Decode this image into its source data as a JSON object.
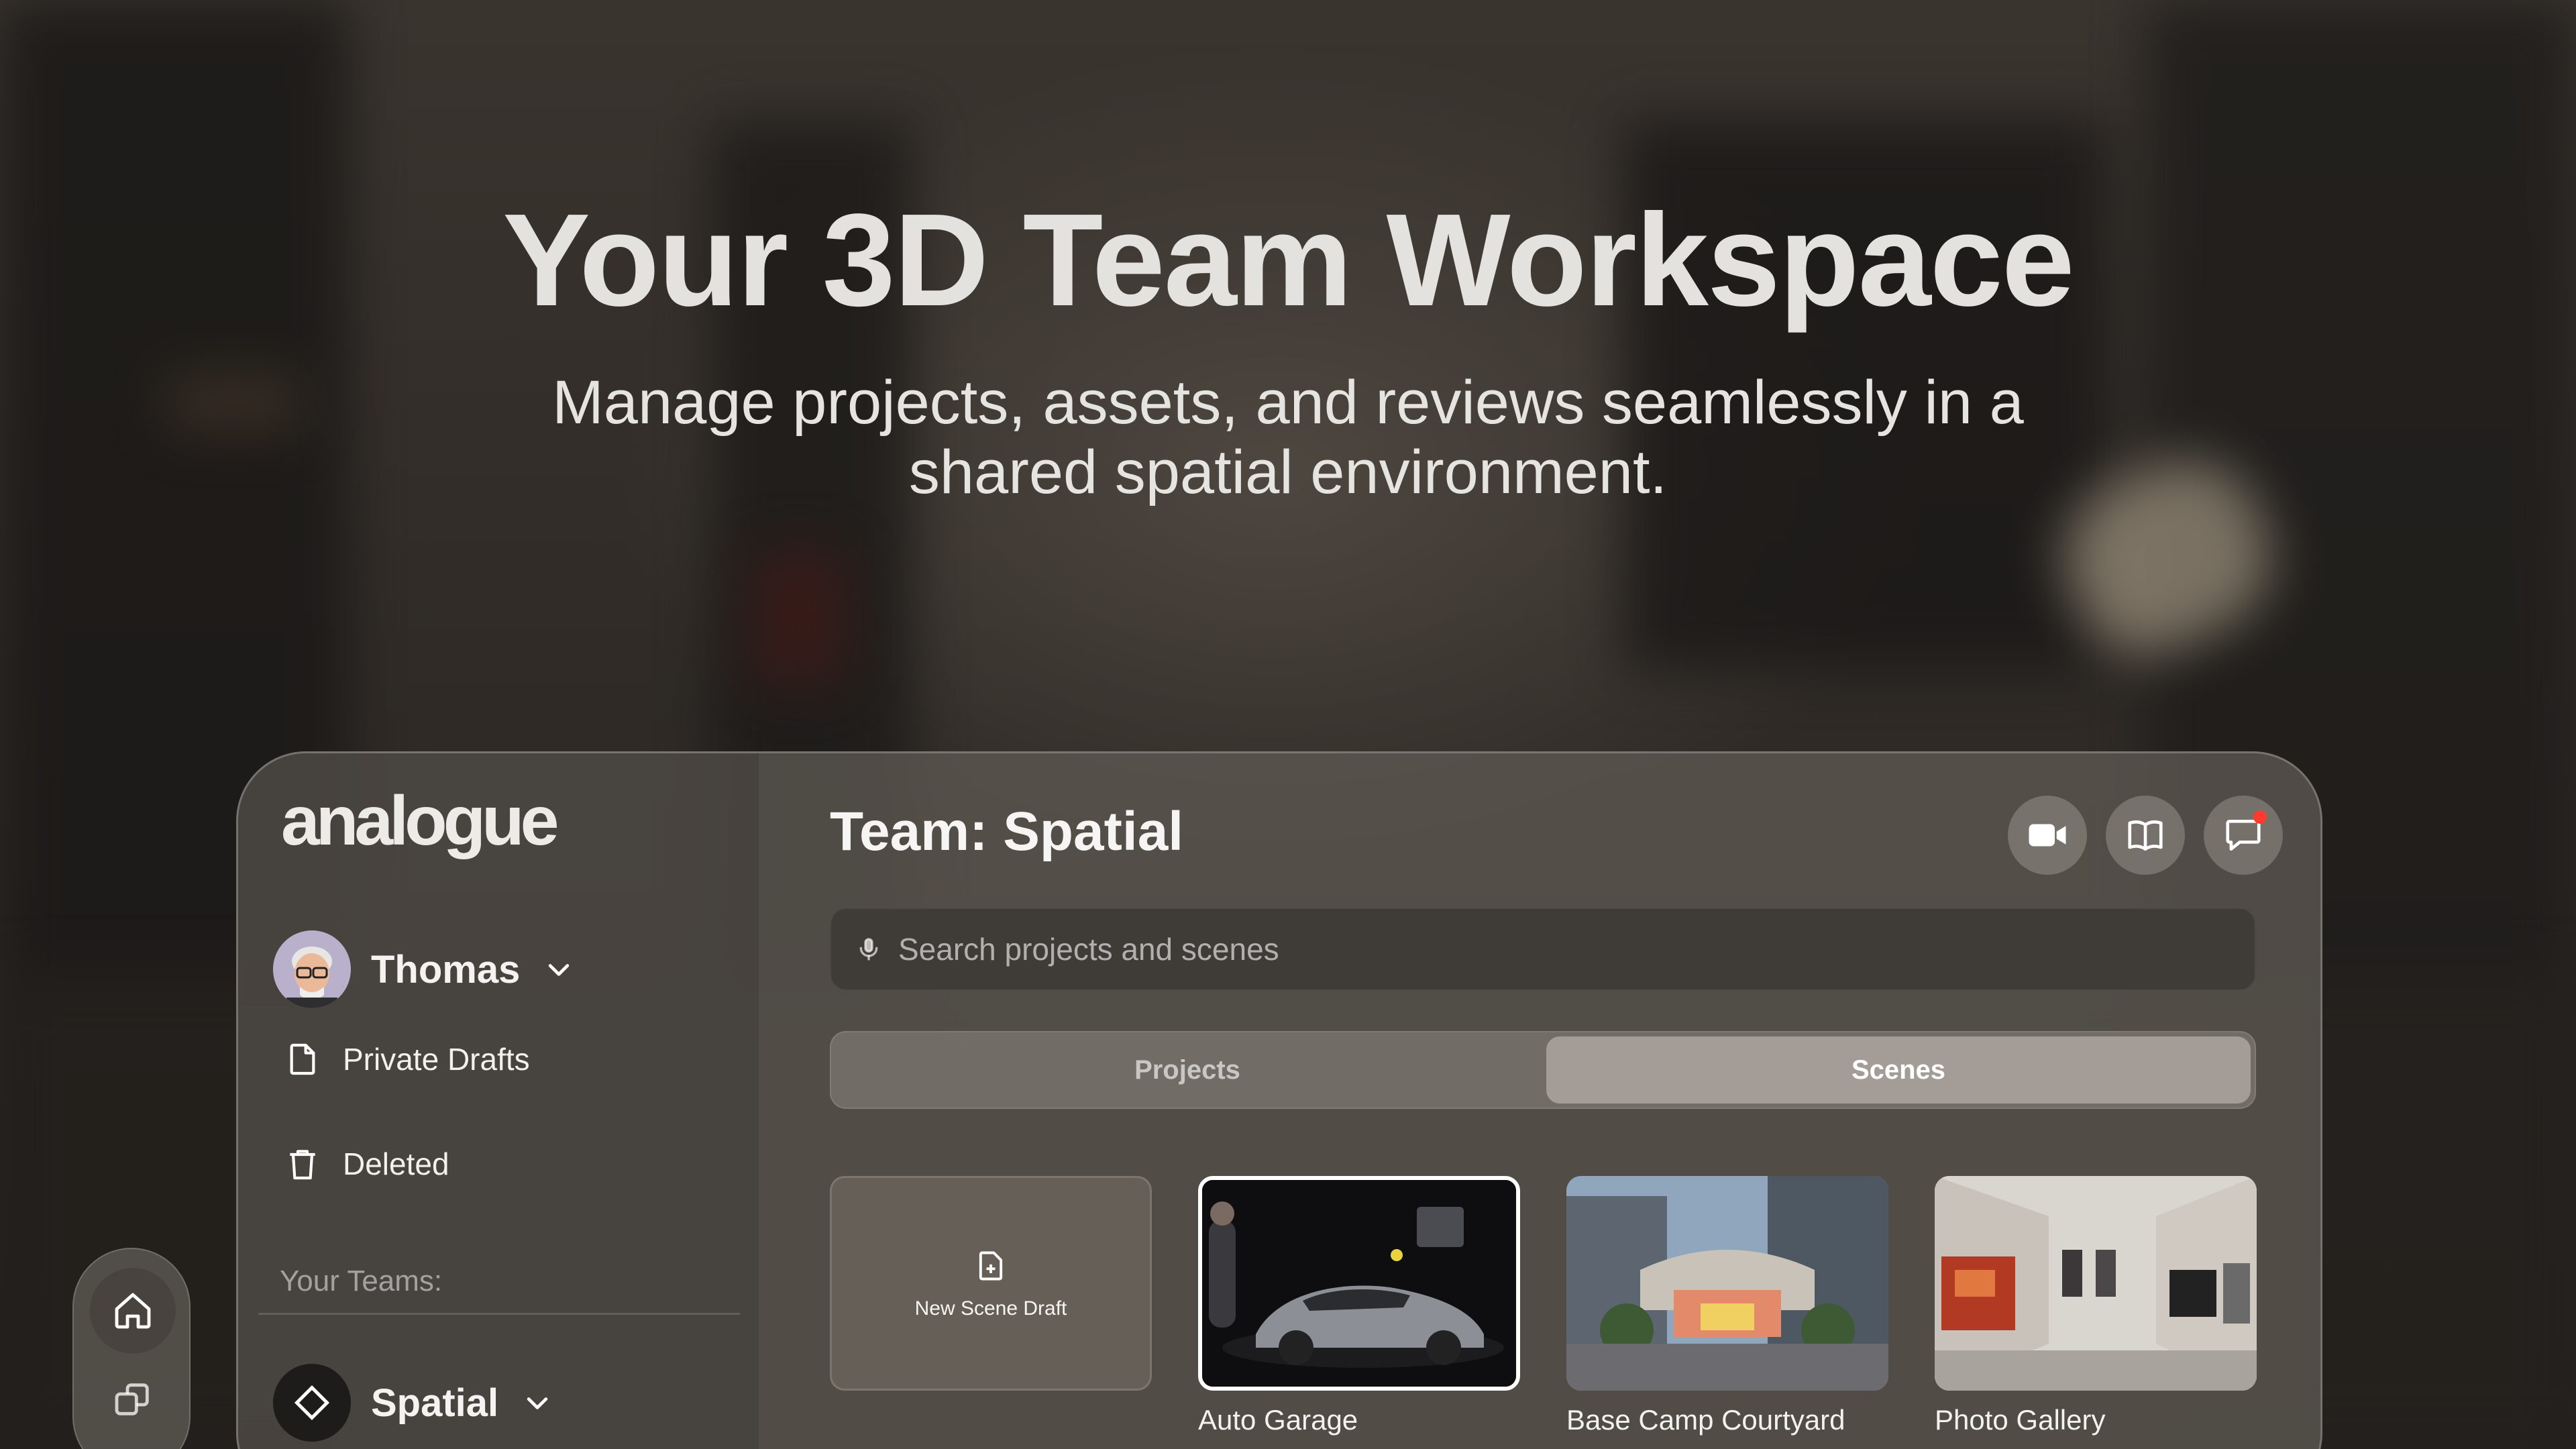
{
  "hero": {
    "title": "Your 3D Team Workspace",
    "subtitle": "Manage projects, assets, and reviews seamlessly in a shared spatial environment."
  },
  "sidebar": {
    "logo": "analogue",
    "user": {
      "name": "Thomas"
    },
    "items": [
      {
        "label": "Private Drafts",
        "icon": "document-icon"
      },
      {
        "label": "Deleted",
        "icon": "trash-icon"
      }
    ],
    "teams_label": "Your Teams:",
    "team": {
      "name": "Spatial",
      "icon": "diamond-icon"
    }
  },
  "header": {
    "title": "Team: Spatial",
    "buttons": [
      "video-camera-icon",
      "book-icon",
      "chat-bubble-icon"
    ]
  },
  "search": {
    "placeholder": "Search projects and scenes",
    "value": ""
  },
  "tabs": [
    {
      "label": "Projects",
      "selected": false
    },
    {
      "label": "Scenes",
      "selected": true
    }
  ],
  "scenes": [
    {
      "label": "New Scene Draft"
    },
    {
      "label": "Auto Garage",
      "selected": true
    },
    {
      "label": "Base Camp Courtyard"
    },
    {
      "label": "Photo Gallery"
    }
  ],
  "rail": {
    "buttons": [
      "home-icon",
      "cube-icon"
    ]
  },
  "colors": {
    "notification": "#ff3b30",
    "selected_border": "#ffffff"
  }
}
